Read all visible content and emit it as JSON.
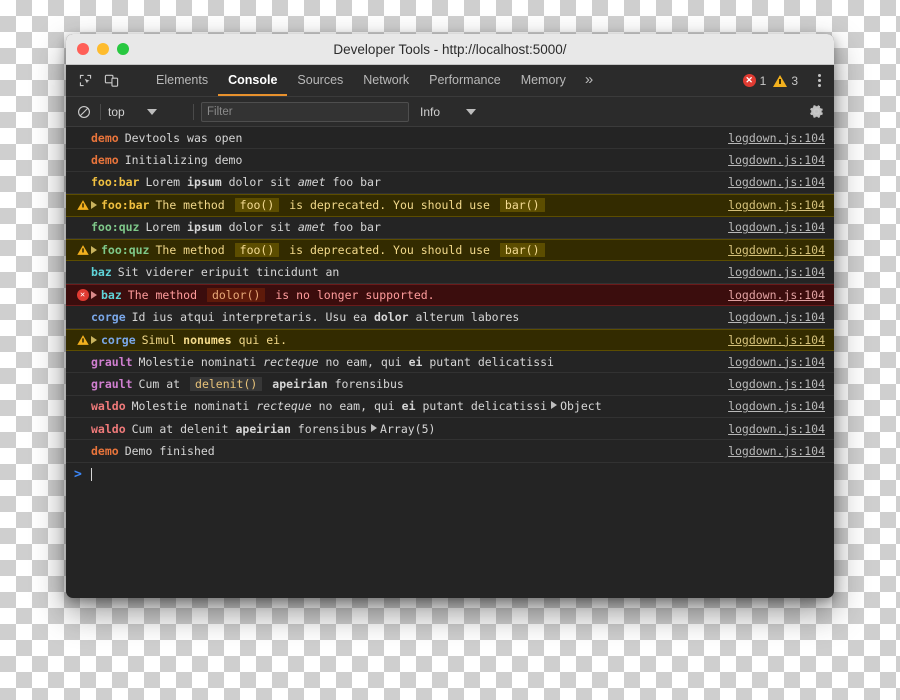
{
  "window": {
    "title": "Developer Tools - http://localhost:5000/",
    "buttons": {
      "close": "close-button",
      "minimize": "minimize-button",
      "zoom": "zoom-button"
    }
  },
  "toolbar": {
    "inspect_icon": "inspect-element-icon",
    "device_icon": "device-toolbar-icon",
    "tabs": [
      {
        "label": "Elements",
        "active": false
      },
      {
        "label": "Console",
        "active": true
      },
      {
        "label": "Sources",
        "active": false
      },
      {
        "label": "Network",
        "active": false
      },
      {
        "label": "Performance",
        "active": false
      },
      {
        "label": "Memory",
        "active": false
      }
    ],
    "more_tabs_label": "»",
    "error_count": "1",
    "warning_count": "3",
    "menu_icon": "kebab-menu-icon"
  },
  "filterbar": {
    "clear_icon": "clear-console-icon",
    "context": "top",
    "filter_placeholder": "Filter",
    "filter_value": "",
    "level": "Info",
    "settings_icon": "gear-icon"
  },
  "colors": {
    "accent": "#e8912d",
    "error": "#e03b32",
    "warning": "#f2b01e",
    "prompt": "#3b86f7",
    "demo": "#e8743b",
    "foobar": "#f0c040",
    "fooquz": "#7fc98a",
    "baz": "#5fd3d8",
    "corge": "#7aa7e8",
    "grault": "#d07fd0",
    "waldo": "#ef7a7a"
  },
  "console": {
    "source_link": "logdown.js:104",
    "rows": [
      {
        "level": "log",
        "icon": "",
        "expando": false,
        "prefix": "demo",
        "prefix_color": "#e8743b",
        "parts": [
          {
            "t": "Devtools was open",
            "s": "n"
          }
        ]
      },
      {
        "level": "log",
        "icon": "",
        "expando": false,
        "prefix": "demo",
        "prefix_color": "#e8743b",
        "parts": [
          {
            "t": "Initializing demo",
            "s": "n"
          }
        ]
      },
      {
        "level": "log",
        "icon": "",
        "expando": false,
        "prefix": "foo:bar",
        "prefix_color": "#f0c040",
        "parts": [
          {
            "t": "Lorem ",
            "s": "n"
          },
          {
            "t": "ipsum",
            "s": "b"
          },
          {
            "t": " dolor sit ",
            "s": "n"
          },
          {
            "t": "amet",
            "s": "i"
          },
          {
            "t": " foo bar",
            "s": "n"
          }
        ]
      },
      {
        "level": "warn",
        "icon": "warning-icon",
        "expando": true,
        "prefix": "foo:bar",
        "prefix_color": "#f0c040",
        "parts": [
          {
            "t": "The method ",
            "s": "n"
          },
          {
            "t": "foo()",
            "s": "c"
          },
          {
            "t": " is deprecated. You should use ",
            "s": "n"
          },
          {
            "t": "bar()",
            "s": "c"
          }
        ]
      },
      {
        "level": "log",
        "icon": "",
        "expando": false,
        "prefix": "foo:quz",
        "prefix_color": "#7fc98a",
        "parts": [
          {
            "t": "Lorem ",
            "s": "n"
          },
          {
            "t": "ipsum",
            "s": "b"
          },
          {
            "t": " dolor sit ",
            "s": "n"
          },
          {
            "t": "amet",
            "s": "i"
          },
          {
            "t": " foo bar",
            "s": "n"
          }
        ]
      },
      {
        "level": "warn",
        "icon": "warning-icon",
        "expando": true,
        "prefix": "foo:quz",
        "prefix_color": "#7fc98a",
        "parts": [
          {
            "t": "The method ",
            "s": "n"
          },
          {
            "t": "foo()",
            "s": "c"
          },
          {
            "t": " is deprecated. You should use ",
            "s": "n"
          },
          {
            "t": "bar()",
            "s": "c"
          }
        ]
      },
      {
        "level": "log",
        "icon": "",
        "expando": false,
        "prefix": "baz",
        "prefix_color": "#5fd3d8",
        "parts": [
          {
            "t": "Sit viderer eripuit tincidunt an",
            "s": "n"
          }
        ]
      },
      {
        "level": "err",
        "icon": "error-icon",
        "expando": true,
        "prefix": "baz",
        "prefix_color": "#5fd3d8",
        "parts": [
          {
            "t": "The method ",
            "s": "n"
          },
          {
            "t": "dolor()",
            "s": "c"
          },
          {
            "t": " is no longer supported.",
            "s": "n"
          }
        ]
      },
      {
        "level": "log",
        "icon": "",
        "expando": false,
        "prefix": "corge",
        "prefix_color": "#7aa7e8",
        "parts": [
          {
            "t": "Id ius atqui interpretaris. Usu ea ",
            "s": "n"
          },
          {
            "t": "dolor",
            "s": "b"
          },
          {
            "t": " alterum labores",
            "s": "n"
          }
        ]
      },
      {
        "level": "warn",
        "icon": "warning-icon",
        "expando": true,
        "prefix": "corge",
        "prefix_color": "#7aa7e8",
        "parts": [
          {
            "t": "Simul ",
            "s": "n"
          },
          {
            "t": "nonumes",
            "s": "b"
          },
          {
            "t": " qui ei.",
            "s": "n"
          }
        ]
      },
      {
        "level": "log",
        "icon": "",
        "expando": false,
        "prefix": "grault",
        "prefix_color": "#d07fd0",
        "parts": [
          {
            "t": "Molestie nominati ",
            "s": "n"
          },
          {
            "t": "recteque",
            "s": "i"
          },
          {
            "t": " no eam, qui ",
            "s": "n"
          },
          {
            "t": "ei",
            "s": "b"
          },
          {
            "t": " putant delicatissi",
            "s": "n"
          }
        ]
      },
      {
        "level": "log",
        "icon": "",
        "expando": false,
        "prefix": "grault",
        "prefix_color": "#d07fd0",
        "parts": [
          {
            "t": "Cum at ",
            "s": "n"
          },
          {
            "t": "delenit()",
            "s": "c"
          },
          {
            "t": " ",
            "s": "n"
          },
          {
            "t": "apeirian",
            "s": "b"
          },
          {
            "t": " forensibus",
            "s": "n"
          }
        ]
      },
      {
        "level": "log",
        "icon": "",
        "expando": false,
        "prefix": "waldo",
        "prefix_color": "#ef7a7a",
        "parts": [
          {
            "t": "Molestie nominati ",
            "s": "n"
          },
          {
            "t": "recteque",
            "s": "i"
          },
          {
            "t": " no eam, qui ",
            "s": "n"
          },
          {
            "t": "ei",
            "s": "b"
          },
          {
            "t": " putant delicatissi",
            "s": "n"
          }
        ],
        "object": "Object"
      },
      {
        "level": "log",
        "icon": "",
        "expando": false,
        "prefix": "waldo",
        "prefix_color": "#ef7a7a",
        "parts": [
          {
            "t": "Cum at delenit ",
            "s": "n"
          },
          {
            "t": "apeirian",
            "s": "b"
          },
          {
            "t": " forensibus",
            "s": "n"
          }
        ],
        "object": "Array(5)"
      },
      {
        "level": "log",
        "icon": "",
        "expando": false,
        "prefix": "demo",
        "prefix_color": "#e8743b",
        "parts": [
          {
            "t": "Demo finished",
            "s": "n"
          }
        ]
      }
    ],
    "prompt_chevron": ">",
    "prompt_value": ""
  }
}
